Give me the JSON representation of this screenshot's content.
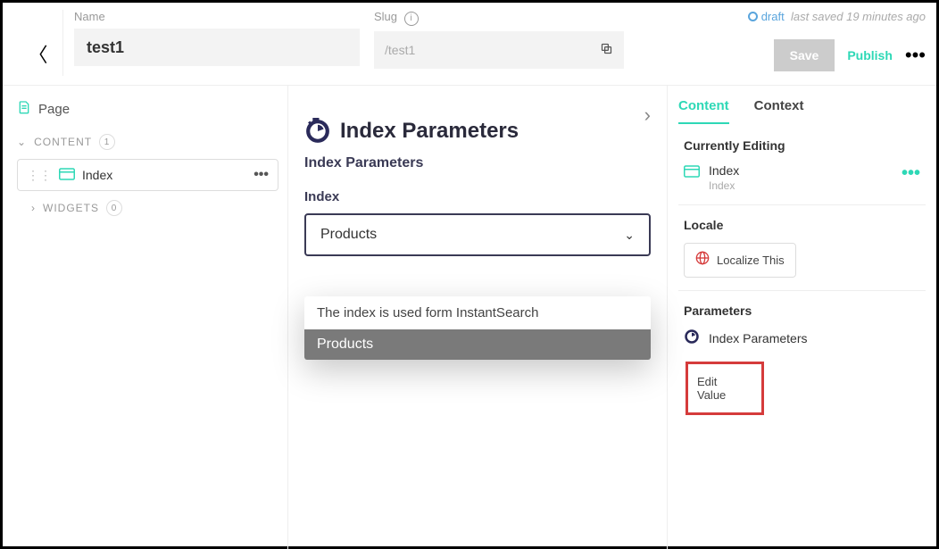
{
  "top": {
    "nameLabel": "Name",
    "nameValue": "test1",
    "slugLabel": "Slug",
    "slugValue": "/test1",
    "draft": "draft",
    "lastSaved": "last saved 19 minutes ago",
    "save": "Save",
    "publish": "Publish",
    "more": "•••"
  },
  "left": {
    "page": "Page",
    "contentHeader": "CONTENT",
    "contentCount": "1",
    "items": [
      {
        "label": "Index"
      }
    ],
    "widgets": "WIDGETS",
    "widgetsCount": "0"
  },
  "mid": {
    "title": "Index Parameters",
    "subtitle": "Index Parameters",
    "fieldLabel": "Index",
    "selected": "Products",
    "dropdown": {
      "hint": "The index is used form InstantSearch",
      "option": "Products"
    }
  },
  "right": {
    "tabs": {
      "content": "Content",
      "context": "Context"
    },
    "editing": {
      "title": "Currently Editing",
      "name": "Index",
      "sub": "Index"
    },
    "locale": {
      "title": "Locale",
      "button": "Localize This"
    },
    "params": {
      "title": "Parameters",
      "item": "Index Parameters",
      "edit": "Edit Value"
    }
  }
}
